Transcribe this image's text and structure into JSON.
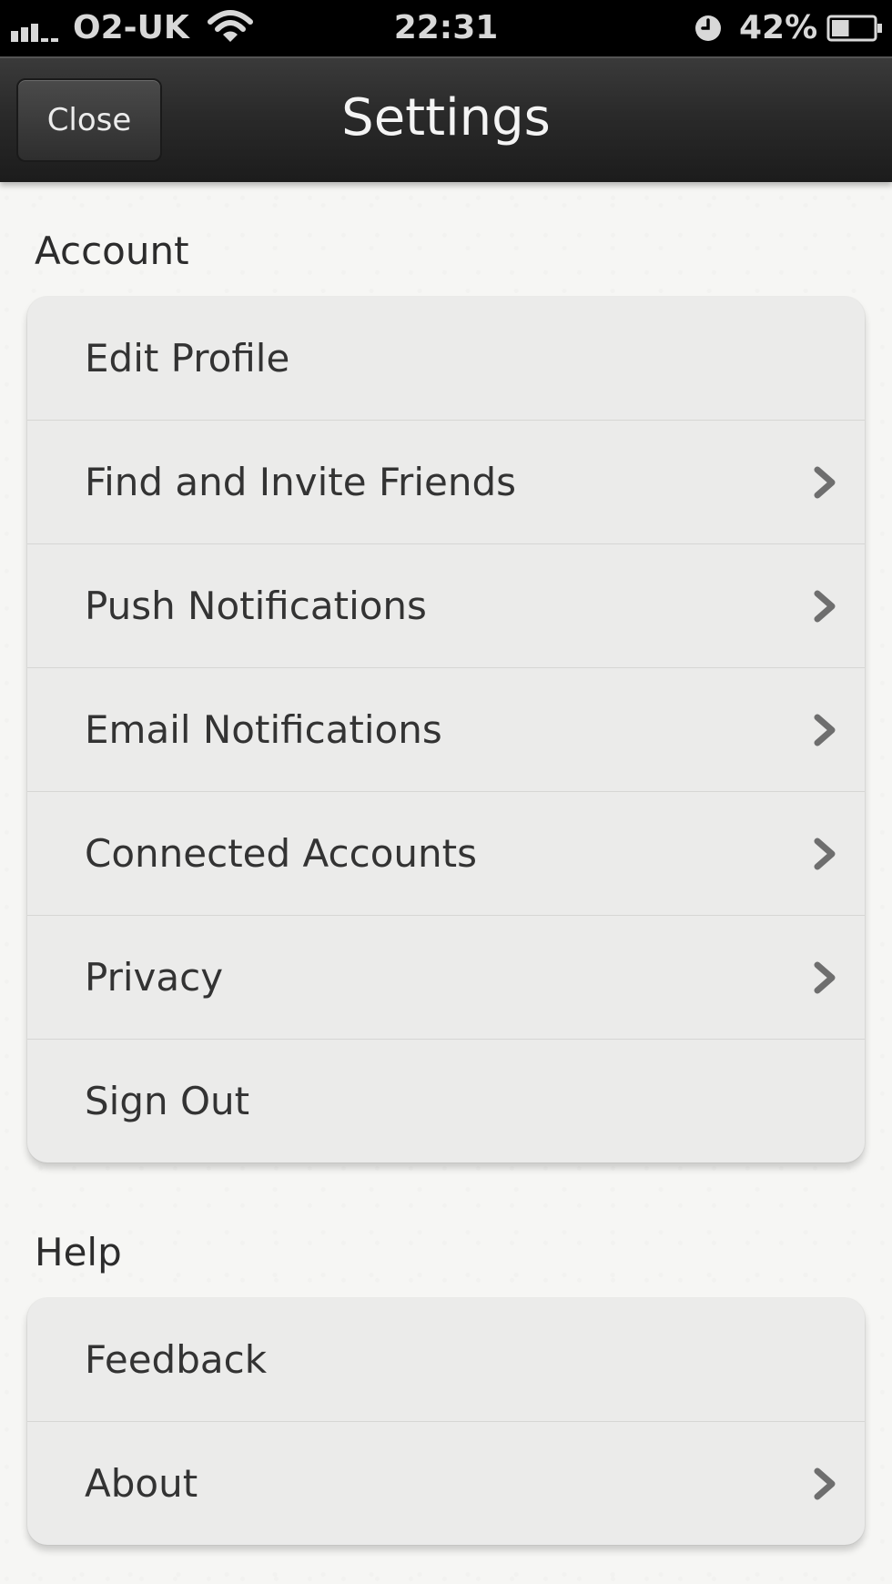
{
  "status_bar": {
    "carrier": "O2-UK",
    "time": "22:31",
    "battery_percent": "42%",
    "icons": [
      "signal-icon",
      "wifi-icon",
      "clock-icon",
      "battery-icon"
    ],
    "battery_level": 0.42
  },
  "nav_bar": {
    "close_label": "Close",
    "title": "Settings"
  },
  "sections": {
    "account": {
      "title": "Account",
      "items": [
        {
          "label": "Edit Profile",
          "chevron": false
        },
        {
          "label": "Find and Invite Friends",
          "chevron": true
        },
        {
          "label": "Push Notifications",
          "chevron": true
        },
        {
          "label": "Email Notifications",
          "chevron": true
        },
        {
          "label": "Connected Accounts",
          "chevron": true
        },
        {
          "label": "Privacy",
          "chevron": true
        },
        {
          "label": "Sign Out",
          "chevron": false
        }
      ]
    },
    "help": {
      "title": "Help",
      "items": [
        {
          "label": "Feedback",
          "chevron": false
        },
        {
          "label": "About",
          "chevron": true
        }
      ]
    }
  },
  "colors": {
    "status_bar_bg": "#000000",
    "nav_bar_bg": "#2a2a2a",
    "text": "#333333",
    "chevron": "#6e6e6e"
  }
}
